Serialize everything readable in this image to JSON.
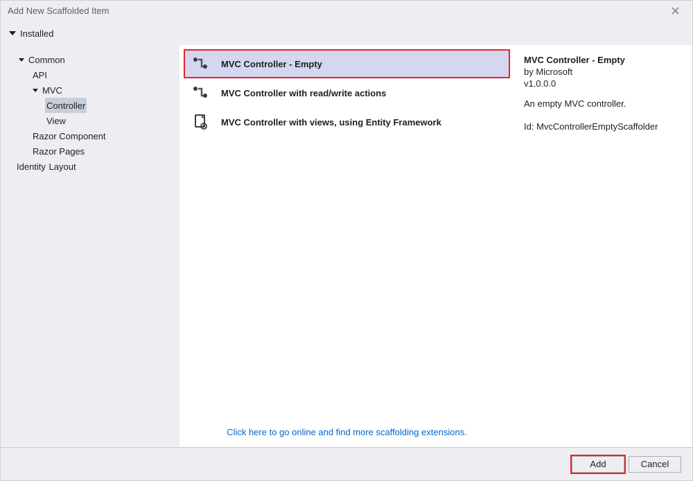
{
  "window": {
    "title": "Add New Scaffolded Item"
  },
  "category_bar": {
    "label": "Installed"
  },
  "sidebar": {
    "common_label": "Common",
    "api_label": "API",
    "mvc_label": "MVC",
    "controller_label": "Controller",
    "view_label": "View",
    "razor_component_label": "Razor Component",
    "razor_pages_label": "Razor Pages",
    "identity_label": "Identity",
    "layout_label": "Layout"
  },
  "templates": {
    "items": [
      {
        "label": "MVC Controller - Empty",
        "selected": true
      },
      {
        "label": "MVC Controller with read/write actions",
        "selected": false
      },
      {
        "label": "MVC Controller with views, using Entity Framework",
        "selected": false
      }
    ],
    "online_link": "Click here to go online and find more scaffolding extensions."
  },
  "details": {
    "title": "MVC Controller - Empty",
    "author_prefix": "by ",
    "author": "Microsoft",
    "version": "v1.0.0.0",
    "description": "An empty MVC controller.",
    "id_prefix": "Id: ",
    "id": "MvcControllerEmptyScaffolder"
  },
  "footer": {
    "add_label": "Add",
    "cancel_label": "Cancel"
  }
}
